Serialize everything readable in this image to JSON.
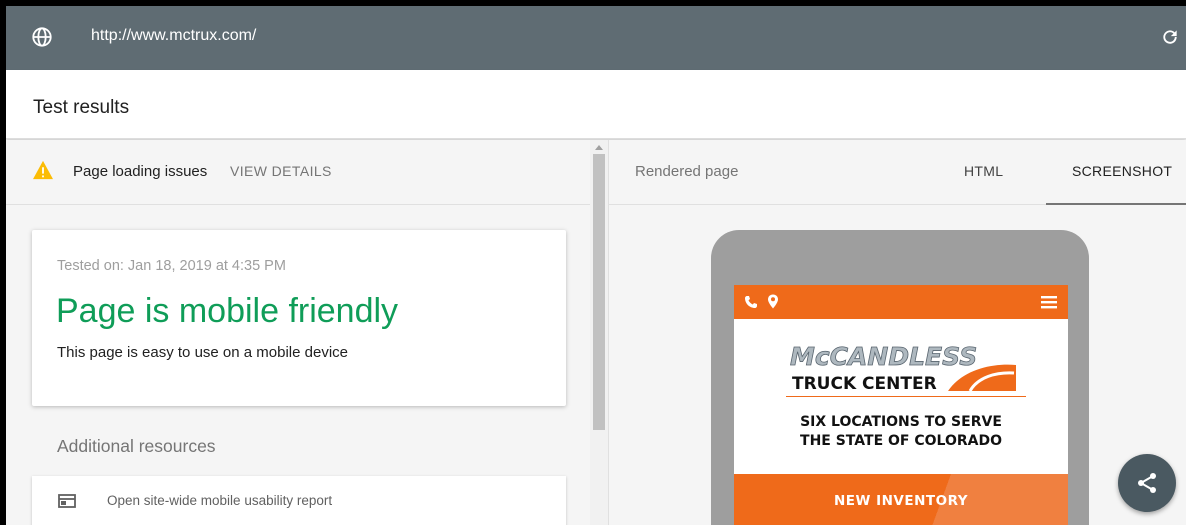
{
  "urlbar": {
    "url": "http://www.mctrux.com/"
  },
  "header": {
    "title": "Test results"
  },
  "issues": {
    "label": "Page loading issues",
    "action": "VIEW DETAILS"
  },
  "result": {
    "tested_on": "Tested on: Jan 18, 2019 at 4:35 PM",
    "verdict": "Page is mobile friendly",
    "description": "This page is easy to use on a mobile device"
  },
  "resources": {
    "heading": "Additional resources",
    "items": [
      {
        "label": "Open site-wide mobile usability report"
      }
    ]
  },
  "rendered": {
    "label": "Rendered page",
    "tabs": [
      {
        "label": "HTML"
      },
      {
        "label": "SCREENSHOT",
        "selected": true
      }
    ]
  },
  "phone": {
    "logo_top": "McCANDLESS",
    "logo_bottom": "TRUCK CENTER",
    "tagline_1": "SIX LOCATIONS TO SERVE",
    "tagline_2": "THE STATE OF COLORADO",
    "cta": "NEW INVENTORY"
  },
  "colors": {
    "urlbar": "#5f6c73",
    "success": "#0f9d58",
    "warning": "#fbbc05",
    "site_orange": "#ef6a1a",
    "fab": "#4a5961"
  },
  "icons": [
    "globe-icon",
    "refresh-icon",
    "warning-icon",
    "report-icon",
    "phone-icon",
    "location-pin-icon",
    "menu-icon",
    "share-icon"
  ]
}
